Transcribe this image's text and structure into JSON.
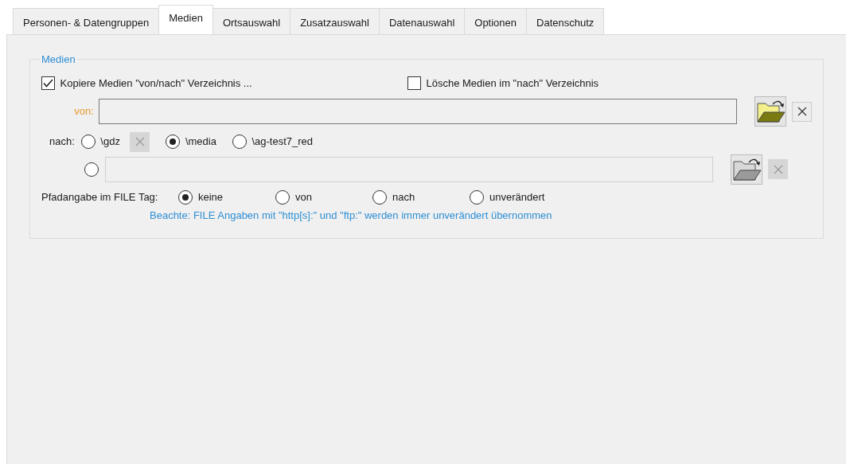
{
  "tabs": [
    {
      "label": "Personen- & Datengruppen",
      "selected": false
    },
    {
      "label": "Medien",
      "selected": true
    },
    {
      "label": "Ortsauswahl",
      "selected": false
    },
    {
      "label": "Zusatzauswahl",
      "selected": false
    },
    {
      "label": "Datenauswahl",
      "selected": false
    },
    {
      "label": "Optionen",
      "selected": false
    },
    {
      "label": "Datenschutz",
      "selected": false
    }
  ],
  "group": {
    "title": "Medien",
    "checkboxes": [
      {
        "label": "Kopiere Medien \"von/nach\" Verzeichnis ...",
        "checked": true
      },
      {
        "label": "Lösche Medien im \"nach\" Verzeichnis",
        "checked": false
      }
    ],
    "von": {
      "label": "von:",
      "disabled": false
    },
    "nach": {
      "label": "nach:",
      "options": [
        {
          "kind": "with-clear",
          "label": "\\gdz",
          "selected": false
        },
        {
          "kind": "plain",
          "label": "\\media",
          "selected": true
        },
        {
          "kind": "plain",
          "label": "\\ag-test7_red",
          "selected": false
        }
      ],
      "custom": {
        "selected": false,
        "disabled": true
      }
    },
    "path": {
      "label": "Pfadangabe im FILE Tag:",
      "options": [
        {
          "label": "keine",
          "selected": true
        },
        {
          "label": "von",
          "selected": false
        },
        {
          "label": "nach",
          "selected": false
        },
        {
          "label": "unverändert",
          "selected": false
        }
      ]
    },
    "note": "Beachte: FILE Angaben mit \"http[s]:\" und \"ftp:\" werden immer unverändert übernommen"
  }
}
